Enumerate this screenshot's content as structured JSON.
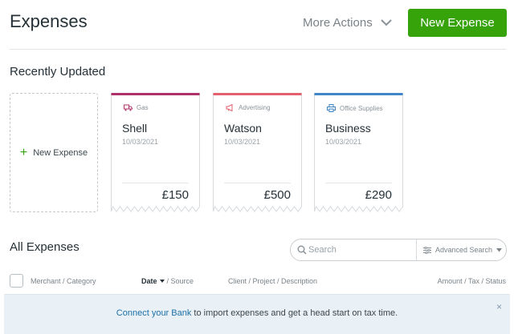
{
  "header": {
    "title": "Expenses",
    "more_actions_label": "More Actions",
    "new_expense_label": "New Expense",
    "brand_green": "#37a30a"
  },
  "recent": {
    "title": "Recently Updated",
    "new_card_label": "New Expense",
    "cards": [
      {
        "category": "Gas",
        "category_icon": "truck-icon",
        "accent": "#b0306a",
        "merchant": "Shell",
        "date": "10/03/2021",
        "amount": "£150"
      },
      {
        "category": "Advertising",
        "category_icon": "megaphone-icon",
        "accent": "#e4606d",
        "merchant": "Watson",
        "date": "10/03/2021",
        "amount": "£500"
      },
      {
        "category": "Office Supplies",
        "category_icon": "printer-icon",
        "accent": "#3e86c8",
        "merchant": "Business",
        "date": "10/03/2021",
        "amount": "£290"
      }
    ]
  },
  "all_expenses": {
    "title": "All Expenses",
    "search_placeholder": "Search",
    "advanced_search_label": "Advanced Search",
    "columns": {
      "merchant": "Merchant / Category",
      "date_key": "Date",
      "date_rest": "/ Source",
      "client": "Client / Project / Description",
      "amount": "Amount / Tax / Status"
    }
  },
  "banner": {
    "link_text": "Connect your Bank",
    "text": " to import expenses and get a head start on tax time.",
    "close_glyph": "×"
  }
}
